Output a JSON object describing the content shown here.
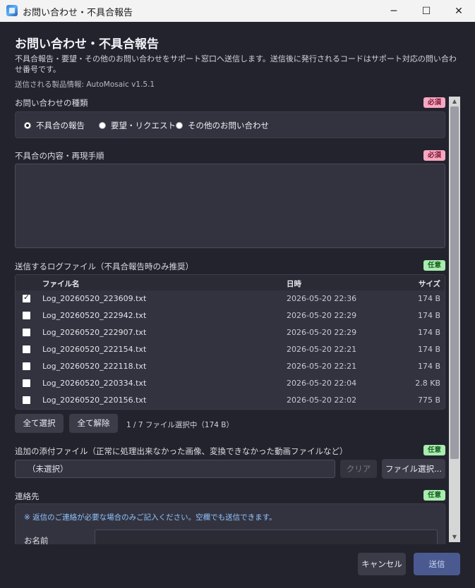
{
  "window": {
    "title": "お問い合わせ・不具合報告",
    "minimize_glyph": "─",
    "maximize_glyph": "☐",
    "close_glyph": "✕"
  },
  "header": {
    "title": "お問い合わせ・不具合報告",
    "description": "不具合報告・要望・その他のお問い合わせをサポート窓口へ送信します。送信後に発行されるコードはサポート対応の問い合わせ番号です。",
    "product_info": "送信される製品情報: AutoMosaic v1.5.1"
  },
  "inquiry_type": {
    "label": "お問い合わせの種類",
    "badge": "必須",
    "options": [
      "不具合の報告",
      "要望・リクエスト",
      "その他のお問い合わせ"
    ],
    "selected": "不具合の報告"
  },
  "details": {
    "label": "不具合の内容・再現手順",
    "badge": "必須",
    "value": ""
  },
  "logs": {
    "label": "送信するログファイル（不具合報告時のみ推奨）",
    "badge": "任意",
    "columns": [
      "ファイル名",
      "日時",
      "サイズ"
    ],
    "rows": [
      {
        "checked": true,
        "name": "Log_20260520_223609.txt",
        "date": "2026-05-20 22:36",
        "size": "174 B"
      },
      {
        "checked": false,
        "name": "Log_20260520_222942.txt",
        "date": "2026-05-20 22:29",
        "size": "174 B"
      },
      {
        "checked": false,
        "name": "Log_20260520_222907.txt",
        "date": "2026-05-20 22:29",
        "size": "174 B"
      },
      {
        "checked": false,
        "name": "Log_20260520_222154.txt",
        "date": "2026-05-20 22:21",
        "size": "174 B"
      },
      {
        "checked": false,
        "name": "Log_20260520_222118.txt",
        "date": "2026-05-20 22:21",
        "size": "174 B"
      },
      {
        "checked": false,
        "name": "Log_20260520_220334.txt",
        "date": "2026-05-20 22:04",
        "size": "2.8 KB"
      },
      {
        "checked": false,
        "name": "Log_20260520_220156.txt",
        "date": "2026-05-20 22:02",
        "size": "775 B"
      }
    ],
    "select_all_label": "全て選択",
    "deselect_all_label": "全て解除",
    "status": "1 / 7 ファイル選択中（174 B）"
  },
  "attachment": {
    "label": "追加の添付ファイル（正常に処理出来なかった画像、変換できなかった動画ファイルなど）",
    "badge": "任意",
    "value": "（未選択）",
    "clear_label": "クリア",
    "choose_label": "ファイル選択..."
  },
  "contact": {
    "label": "連絡先",
    "badge": "任意",
    "note": "※ 返信のご連絡が必要な場合のみご記入ください。空欄でも送信できます。",
    "name_label": "お名前",
    "name_value": ""
  },
  "scrollbar": {
    "up_glyph": "▲",
    "down_glyph": "▼"
  },
  "footer": {
    "cancel_label": "キャンセル",
    "send_label": "送信"
  }
}
